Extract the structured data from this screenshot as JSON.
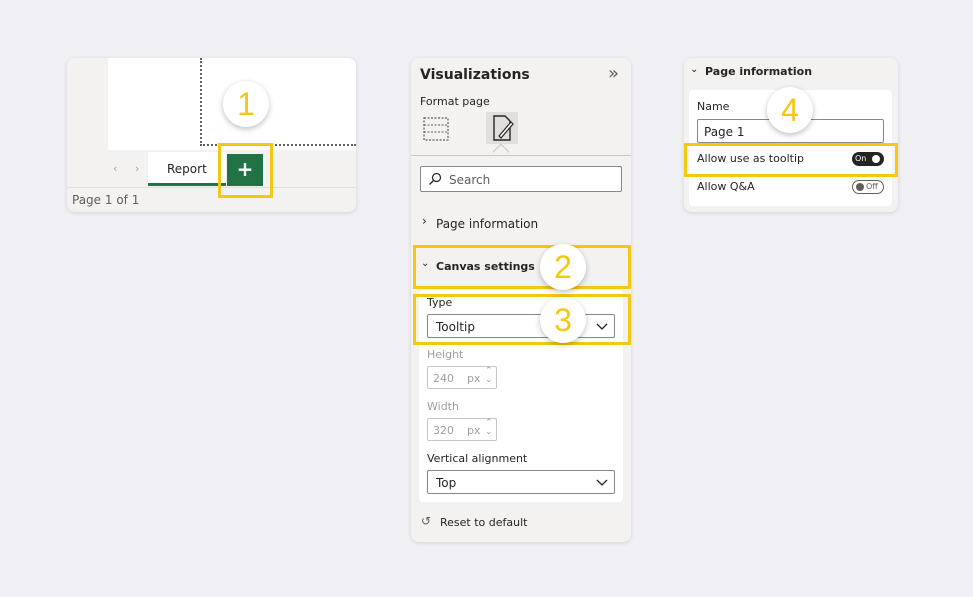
{
  "panel1": {
    "tab_label": "Report",
    "add_page_label": "+",
    "page_status": "Page 1 of 1",
    "nav_prev": "‹",
    "nav_next": "›"
  },
  "panel2": {
    "title": "Visualizations",
    "collapse_glyph": "»",
    "subtitle": "Format page",
    "search_placeholder": "Search",
    "page_info_label": "Page information",
    "canvas_settings_label": "Canvas settings",
    "type_label": "Type",
    "type_value": "Tooltip",
    "height_label": "Height",
    "height_value": "240",
    "width_label": "Width",
    "width_value": "320",
    "unit": "px",
    "valign_label": "Vertical alignment",
    "valign_value": "Top",
    "reset_label": "Reset to default"
  },
  "panel3": {
    "title": "Page information",
    "name_label": "Name",
    "name_value": "Page 1",
    "tooltip_label": "Allow use as tooltip",
    "tooltip_state": "On",
    "qa_label": "Allow Q&A",
    "qa_state": "Off"
  },
  "badges": [
    "1",
    "2",
    "3",
    "4"
  ],
  "colors": {
    "accent": "#217346",
    "highlight": "#f2c811"
  }
}
